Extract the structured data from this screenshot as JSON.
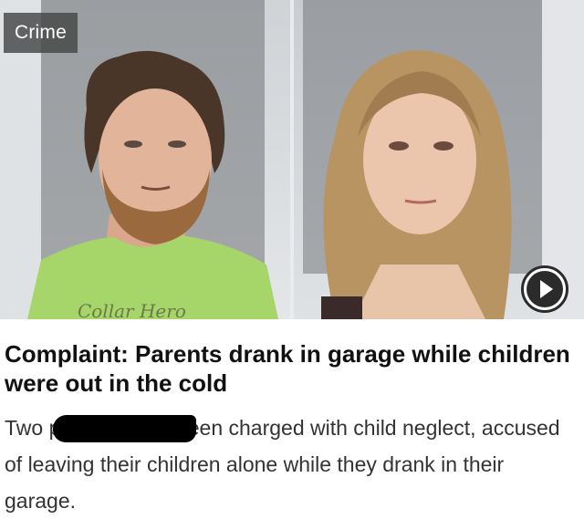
{
  "badge": {
    "label": "Crime"
  },
  "images": {
    "left": {
      "shirt_text": "Collar Hero"
    }
  },
  "article": {
    "headline": "Complaint: Parents drank in garage while children were out in the cold",
    "summary": "Two                              parents have been charged with child neglect, accused of leaving their children alone while they drank in their garage."
  },
  "colors": {
    "badge_bg": "#464646",
    "shirt": "#a6d56a",
    "headline": "#111111",
    "body_text": "#333333"
  },
  "icons": {
    "play": "play-circle-icon"
  }
}
